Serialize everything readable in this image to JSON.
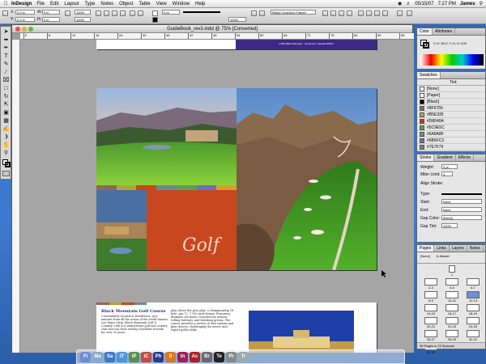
{
  "menubar": {
    "app": "InDesign",
    "items": [
      "File",
      "Edit",
      "Layout",
      "Type",
      "Notes",
      "Object",
      "Table",
      "View",
      "Window",
      "Help"
    ],
    "date": "05/15/07",
    "time": "7:27 PM",
    "user": "James"
  },
  "control": {
    "x": "0.0 in",
    "y": "0.0 in",
    "w": "0 in",
    "h": "0 in",
    "zoom": "100%",
    "stroke_weight": "0 pt",
    "opacity": "100%",
    "frame_style": "[Basic Graphics Frame]"
  },
  "document": {
    "title": "GuideBook_rev3.indd @ 75% [Converted]",
    "ruler_labels": [
      "0",
      "6",
      "12",
      "18",
      "24",
      "30",
      "36",
      "42",
      "48",
      "54",
      "60",
      "66",
      "72",
      "78",
      "84",
      "90",
      "96"
    ],
    "spread2": {
      "heading": "Black Mountain Golf Course",
      "col1": "Conveniently located in Henderson, just minutes from all the action of the world famous Las Vegas Strip, Black Mountain Golf & Country Club is a semi-private golf and country club that has been serving Southern Nevada for over 50 years.",
      "col2": "play where the pros play: a championship 18 hole, par 72, 7,100 yard design. Featuring dramatic tee boxes, treacherous ravines, rolling fairways, and breaking greens. The course provides a variety of shot options and play choices, challenging the novice and expert golfer alike."
    },
    "script_word": "Golf",
    "top_banner": "1-800-Black Mountain · Henderson, Nevada 89074"
  },
  "color_panel": {
    "tabs": [
      "Color",
      "Attributes"
    ],
    "values": "C=0, M=0, Y=0, K=100"
  },
  "swatches_panel": {
    "tabs": [
      "Swatches"
    ],
    "tint_label": "Tint:",
    "items": [
      {
        "name": "[None]",
        "color": "#ffffff"
      },
      {
        "name": "[Paper]",
        "color": "#ffffff"
      },
      {
        "name": "[Black]",
        "color": "#000000"
      },
      {
        "name": "#8F6756",
        "color": "#8f6756"
      },
      {
        "name": "#B5E335",
        "color": "#b5a335"
      },
      {
        "name": "#D8040A",
        "color": "#c03a1a"
      },
      {
        "name": "#5C9E5C",
        "color": "#5c9e5c"
      },
      {
        "name": "#6A8A8F",
        "color": "#6a8a8f"
      },
      {
        "name": "#6B6FC2",
        "color": "#6b6fc2"
      },
      {
        "name": "#7E7F79",
        "color": "#7e7f79"
      }
    ]
  },
  "stroke_panel": {
    "tabs": [
      "Stroke",
      "Gradient",
      "Effects"
    ],
    "weight_label": "Weight:",
    "weight": "0 pt",
    "miter_label": "Miter Limit:",
    "miter": "4",
    "align_label": "Align Stroke:",
    "type_label": "Type:",
    "start_label": "Start:",
    "start": "None",
    "end_label": "End:",
    "end": "None",
    "gap_color_label": "Gap Color:",
    "gap_color": "[None]",
    "gap_tint_label": "Gap Tint:",
    "gap_tint": "100%"
  },
  "pages_panel": {
    "tabs": [
      "Pages",
      "Links",
      "Layers",
      "Notes"
    ],
    "masters": [
      "[None]",
      "A-Master"
    ],
    "pages": [
      "1",
      "2-3",
      "4-5",
      "6-7",
      "8-9",
      "10-11",
      "12-13",
      "14-15",
      "16-17",
      "18-19",
      "20-21",
      "22-23",
      "24-25",
      "26-27",
      "28-29",
      "30-31",
      "32-33"
    ],
    "footer": "36 Pages in 15 Spreads"
  },
  "dock": {
    "apps": [
      "Finder",
      "Mail",
      "Safari",
      "iTunes",
      "iPhoto",
      "iCal",
      "Photoshop",
      "Illustrator",
      "InDesign",
      "Acrobat",
      "Bridge",
      "Terminal",
      "Prefs",
      "Trash"
    ]
  },
  "colors": {
    "accent_orange": "#c8471f",
    "banner_purple": "#3b2a84"
  }
}
